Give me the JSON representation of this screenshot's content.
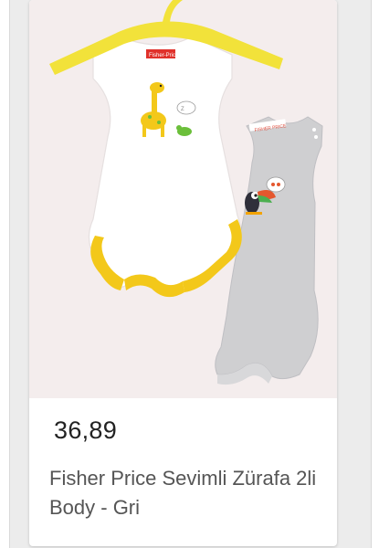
{
  "product": {
    "price": "36,89",
    "title": "Fisher Price Sevimli Zürafa 2li Body - Gri",
    "image_alt": "Two sleeveless baby bodysuits on a yellow hanger",
    "brand_tag": "Fisher-Price"
  },
  "colors": {
    "background": "#ececec",
    "card": "#ffffff",
    "image_bg": "#f4eded",
    "hanger": "#f2e23a",
    "trim": "#f3c81a",
    "grey_body": "#cfcfd1",
    "price_text": "#222222",
    "title_text": "#555555"
  }
}
